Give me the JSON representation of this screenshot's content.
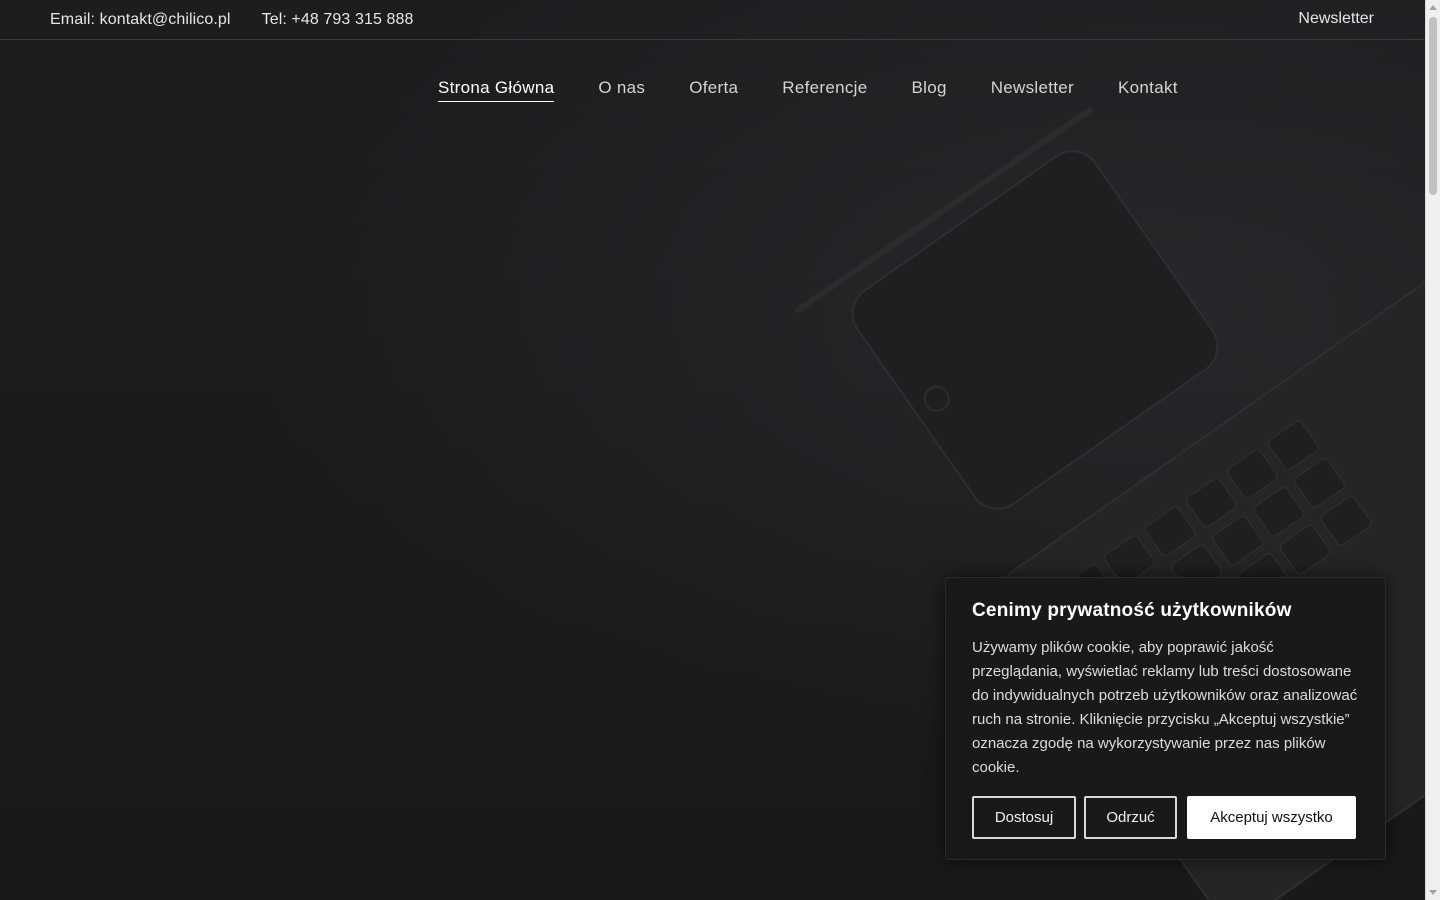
{
  "topbar": {
    "email": "Email: kontakt@chilico.pl",
    "phone": "Tel: +48 793 315 888",
    "newsletter": "Newsletter"
  },
  "nav": {
    "items": [
      {
        "label": "Strona Główna",
        "active": true
      },
      {
        "label": "O nas"
      },
      {
        "label": "Oferta"
      },
      {
        "label": "Referencje"
      },
      {
        "label": "Blog"
      },
      {
        "label": "Newsletter"
      },
      {
        "label": "Kontakt"
      }
    ]
  },
  "cookie": {
    "title": "Cenimy prywatność użytkowników",
    "text": "Używamy plików cookie, aby poprawić jakość przeglądania, wyświetlać reklamy lub treści dostosowane do indywidualnych potrzeb użytkowników oraz analizować ruch na stronie. Kliknięcie przycisku „Akceptuj wszystkie” oznacza zgodę na wykorzystywanie przez nas plików cookie.",
    "customize_label": "Dostosuj",
    "reject_label": "Odrzuć",
    "accept_label": "Akceptuj wszystko"
  },
  "colors": {
    "background": "#1a1b1c",
    "text": "#e6e6e6",
    "button_solid": "#ffffff"
  }
}
